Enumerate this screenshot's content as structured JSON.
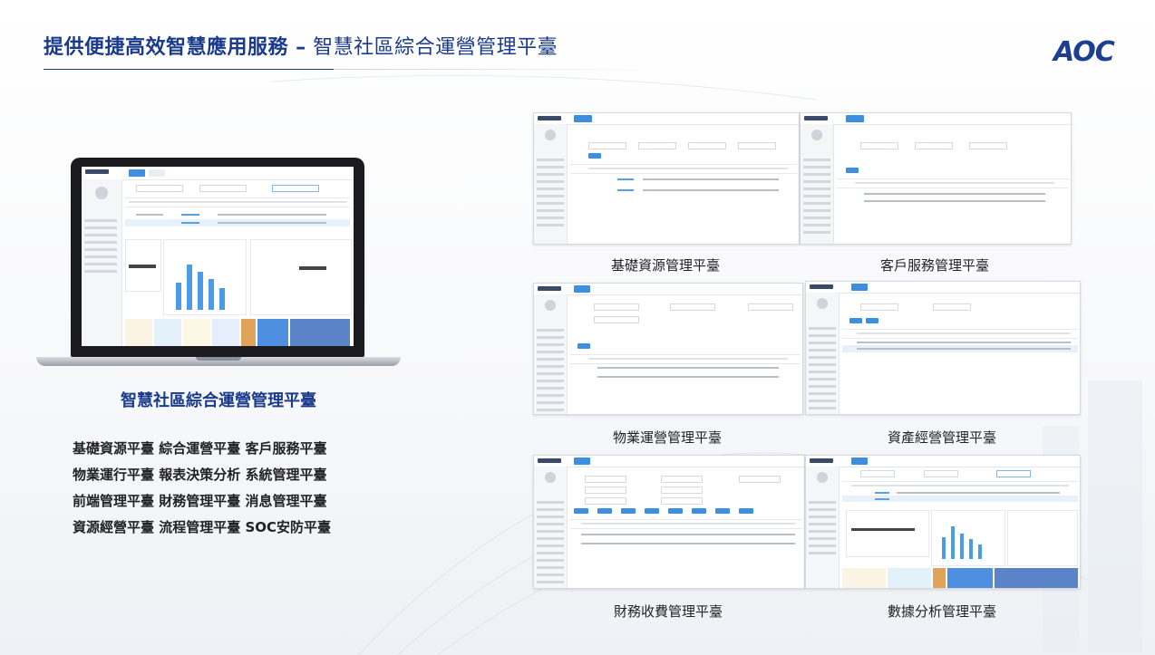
{
  "slide": {
    "title_bold": "提供便捷高效智慧應用服務 –",
    "title_rest": " 智慧社區綜合運營管理平臺",
    "brand": "AOC",
    "brand_color": "#1d3f92",
    "accent_color": "#1a3a8c"
  },
  "laptop": {
    "caption": "智慧社區綜合運營管理平臺"
  },
  "features": [
    "基礎資源平臺  綜合運營平臺   客戶服務平臺",
    "物業運行平臺  報表決策分析   系統管理平臺",
    "前端管理平臺  財務管理平臺   消息管理平臺",
    "資源經營平臺  流程管理平臺  SOC安防平臺"
  ],
  "screens": [
    {
      "caption": "基礎資源管理平臺"
    },
    {
      "caption": "客戶服務管理平臺"
    },
    {
      "caption": "物業運營管理平臺"
    },
    {
      "caption": "資產經營管理平臺"
    },
    {
      "caption": "財務收費管理平臺"
    },
    {
      "caption": "數據分析管理平臺"
    }
  ]
}
